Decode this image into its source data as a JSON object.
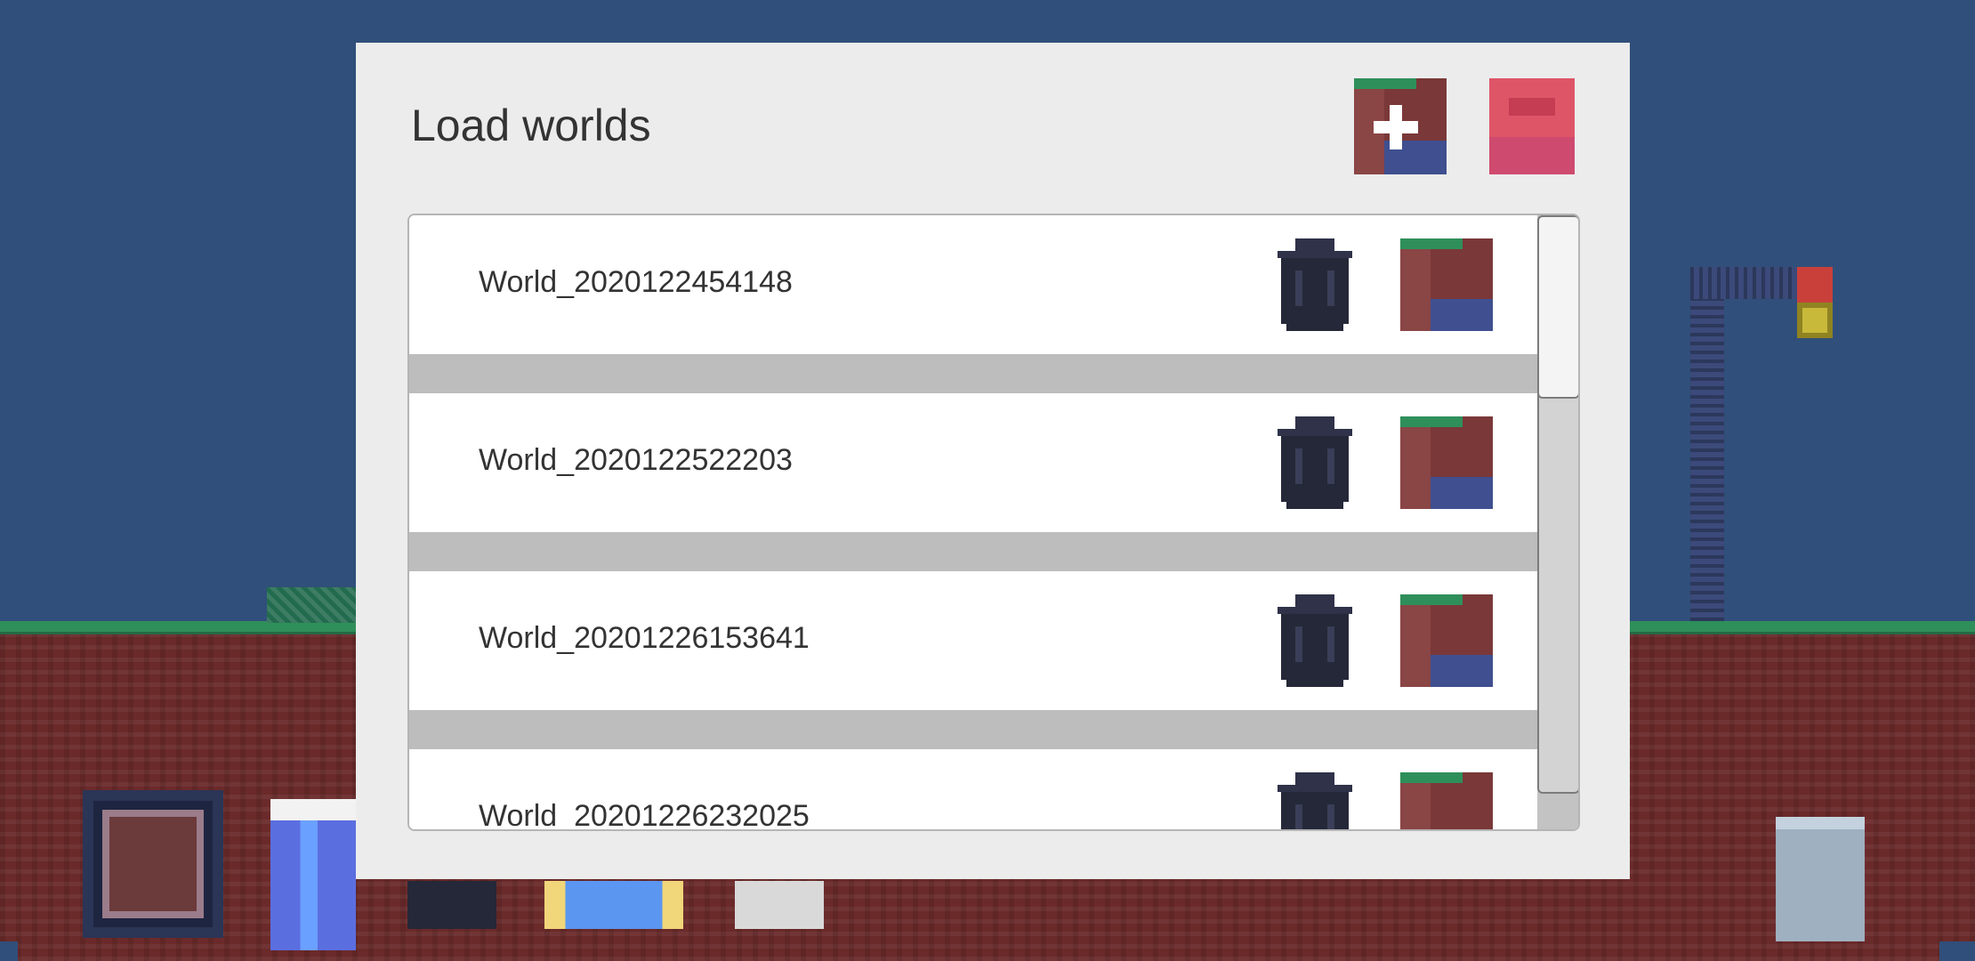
{
  "dialog": {
    "title": "Load worlds"
  },
  "worlds": [
    {
      "name": "World_2020122454148"
    },
    {
      "name": "World_2020122522203"
    },
    {
      "name": "World_20201226153641"
    },
    {
      "name": "World_20201226232025"
    }
  ],
  "icons": {
    "new_world": "new-world-icon",
    "close": "close-icon",
    "delete": "trash-can-icon",
    "load": "world-tile-icon"
  },
  "colors": {
    "sky": "#304f7a",
    "dialog_bg": "#ececec",
    "separator": "#bdbdbd",
    "close_button": "#de5568",
    "trash": "#252838",
    "grass": "#2f8f5a",
    "dirt": "#6b2a2a",
    "water": "#3f4f8f"
  }
}
